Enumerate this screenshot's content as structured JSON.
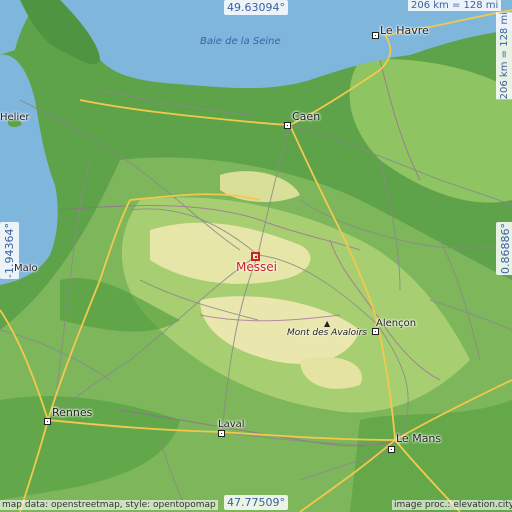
{
  "map": {
    "colors": {
      "sea": "#7fb6dc",
      "lowland": "#4c9a3a",
      "midland": "#9bc86a",
      "upland": "#e3e3a4",
      "motorway": "#f2c94c",
      "road": "#888888",
      "border": "#a060a0"
    },
    "sea_label": "Baie de la Seine",
    "selected": {
      "name": "Messei",
      "icon": "square-marker-icon"
    },
    "cities": [
      {
        "key": "le-havre",
        "name": "Le Havre"
      },
      {
        "key": "caen",
        "name": "Caen"
      },
      {
        "key": "helier",
        "name": "Helier"
      },
      {
        "key": "malo",
        "name": "Malo"
      },
      {
        "key": "rennes",
        "name": "Rennes"
      },
      {
        "key": "laval",
        "name": "Laval"
      },
      {
        "key": "alencon",
        "name": "Alençon"
      },
      {
        "key": "le-mans",
        "name": "Le Mans"
      }
    ],
    "peak": {
      "name": "Mont des Avaloirs",
      "icon": "peak-triangle-icon"
    },
    "coordinates": {
      "top": "49.63094°",
      "bottom": "47.77509°",
      "left": "-1.94364°",
      "right": "0.86886°"
    },
    "scale": {
      "horizontal": "206 km = 128 mi",
      "vertical": "206 km = 128 mi"
    },
    "credits": {
      "left": "map data: openstreetmap, style: opentopomap",
      "right": "image proc.: elevation.city"
    }
  }
}
